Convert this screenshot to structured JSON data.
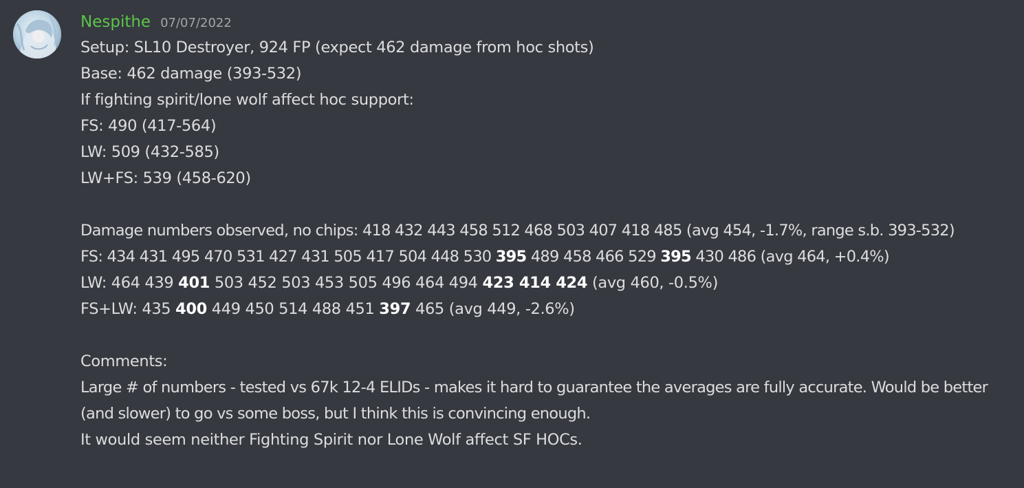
{
  "author": {
    "name": "Nespithe",
    "timestamp": "07/07/2022"
  },
  "colors": {
    "background": "#36393f",
    "username": "#5cc54b",
    "text": "#dcddde",
    "timestamp": "#a3a6aa"
  },
  "message": {
    "setup": "Setup: SL10 Destroyer, 924 FP (expect 462 damage from hoc shots)",
    "base": "Base: 462 damage (393-532)",
    "if_line": "If fighting spirit/lone wolf affect hoc support:",
    "fs_expected": "FS: 490 (417-564)",
    "lw_expected": "LW: 509 (432-585)",
    "lwfs_expected": "LW+FS: 539 (458-620)",
    "observed": "Damage numbers observed, no chips: 418 432 443 458 512 468 503 407 418 485 (avg 454, -1.7%, range s.b. 393-532)",
    "fs_obs": {
      "p1": "FS: 434 431 495 470 531 427 431 505 417 504 448 530 ",
      "b1": "395",
      "p2": " 489 458 466 529 ",
      "b2": "395",
      "p3": " 430 486 (avg 464, +0.4%)"
    },
    "lw_obs": {
      "p1": "LW: 464 439 ",
      "b1": "401",
      "p2": " 503 452 503 453 505 496 464 494 ",
      "b2": "423 414 424",
      "p3": " (avg 460, -0.5%)"
    },
    "fslw_obs": {
      "p1": "FS+LW: 435 ",
      "b1": "400",
      "p2": " 449 450 514 488 451 ",
      "b2": "397",
      "p3": " 465 (avg 449, -2.6%)"
    },
    "comments_label": "Comments:",
    "comment1": "Large # of numbers - tested vs 67k 12-4 ELIDs - makes it hard to guarantee the averages are fully accurate. Would be better (and slower) to go vs some boss, but I think this is convincing enough.",
    "comment2": "It would seem neither Fighting Spirit nor Lone Wolf affect SF HOCs."
  }
}
